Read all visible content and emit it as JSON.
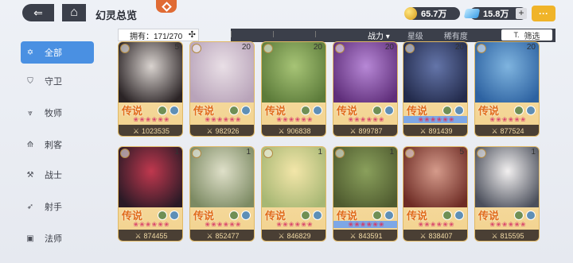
{
  "header": {
    "title": "幻灵总览",
    "gold": "65.7万",
    "gems": "15.8万",
    "plus": "+",
    "chat": "···"
  },
  "owned": {
    "label": "拥有：171/270",
    "expand_icon": "expand-icon"
  },
  "filters": {
    "power": "战力 ▾",
    "star": "星级",
    "rarity": "稀有度",
    "filter": "筛选"
  },
  "sidebar": {
    "items": [
      {
        "label": "全部",
        "icon": "hexagram-icon",
        "active": true
      },
      {
        "label": "守卫",
        "icon": "shield-icon"
      },
      {
        "label": "牧师",
        "icon": "wings-icon"
      },
      {
        "label": "刺客",
        "icon": "dagger-icon"
      },
      {
        "label": "战士",
        "icon": "axe-icon"
      },
      {
        "label": "射手",
        "icon": "bow-icon"
      },
      {
        "label": "法师",
        "icon": "book-icon"
      }
    ]
  },
  "cards": [
    {
      "rank": "传说",
      "power": "1023535",
      "level": "5",
      "stars_blue": false,
      "art": [
        "#d9d3cf",
        "#2b2426"
      ]
    },
    {
      "rank": "传说",
      "power": "982926",
      "level": "20",
      "stars_blue": false,
      "art": [
        "#e9dfe6",
        "#b8a3b9"
      ]
    },
    {
      "rank": "传说",
      "power": "906838",
      "level": "20",
      "stars_blue": false,
      "art": [
        "#a7c476",
        "#5c7b3a"
      ]
    },
    {
      "rank": "传说",
      "power": "899787",
      "level": "20",
      "stars_blue": false,
      "art": [
        "#b788d6",
        "#5f2e7a"
      ]
    },
    {
      "rank": "传说",
      "power": "891439",
      "level": "20",
      "stars_blue": true,
      "art": [
        "#6475a9",
        "#232b4c"
      ]
    },
    {
      "rank": "传说",
      "power": "877524",
      "level": "20",
      "stars_blue": false,
      "art": [
        "#7fb4df",
        "#2d62a1"
      ]
    },
    {
      "rank": "传说",
      "power": "874455",
      "level": "1",
      "stars_blue": false,
      "art": [
        "#c0384e",
        "#2a1a26"
      ]
    },
    {
      "rank": "传说",
      "power": "852477",
      "level": "1",
      "stars_blue": false,
      "art": [
        "#dfe0c9",
        "#7c8a63"
      ]
    },
    {
      "rank": "传说",
      "power": "846829",
      "level": "1",
      "stars_blue": false,
      "art": [
        "#f3e6a9",
        "#a7b774"
      ]
    },
    {
      "rank": "传说",
      "power": "843591",
      "level": "1",
      "stars_blue": true,
      "art": [
        "#8aa05c",
        "#4f5b2f"
      ]
    },
    {
      "rank": "传说",
      "power": "838407",
      "level": "5",
      "stars_blue": false,
      "art": [
        "#d59b8b",
        "#6e2c25"
      ]
    },
    {
      "rank": "传说",
      "power": "815595",
      "level": "1",
      "stars_blue": false,
      "art": [
        "#f2f0f0",
        "#4b4f5b"
      ]
    }
  ]
}
